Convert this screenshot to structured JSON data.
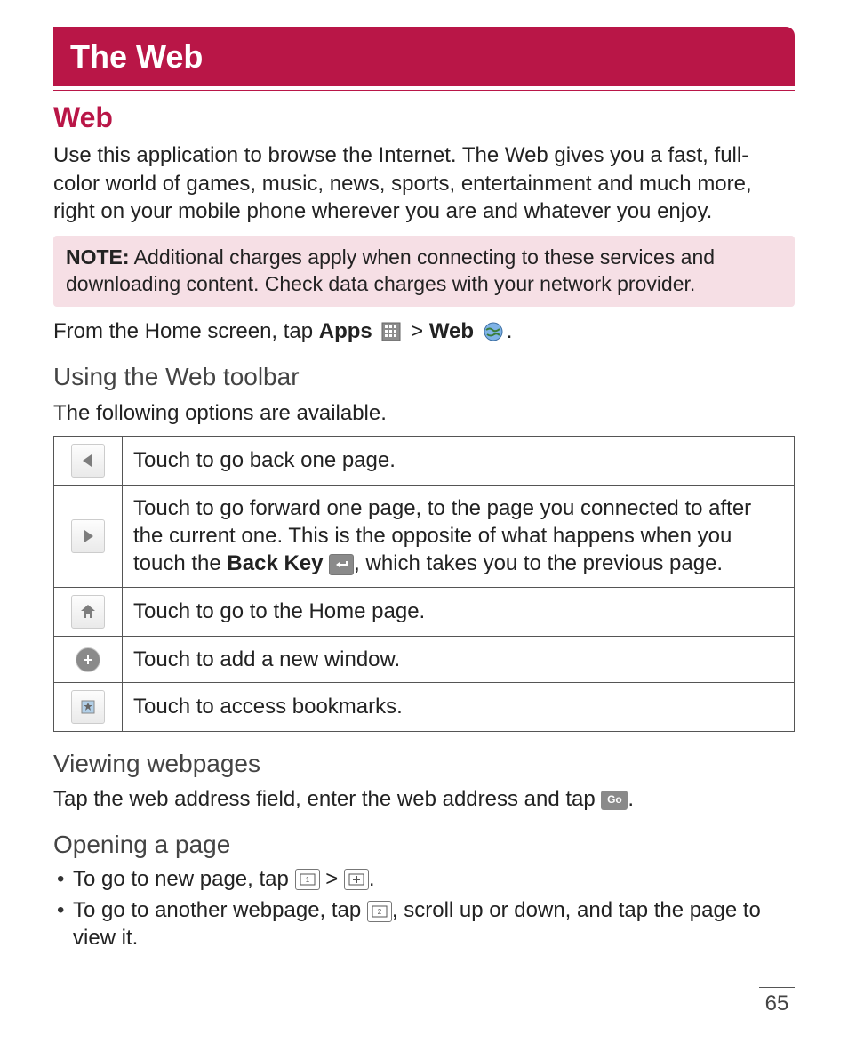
{
  "chapter_title": "The Web",
  "section_title": "Web",
  "intro_paragraph": "Use this application to browse the Internet. The Web gives you a fast, full-color world of games, music, news, sports, entertainment and much more, right on your mobile phone wherever you are and whatever you enjoy.",
  "note": {
    "label": "NOTE:",
    "text": " Additional charges apply when connecting to these services and downloading content. Check data charges with your network provider."
  },
  "from_home": {
    "pre": "From the Home screen, tap ",
    "apps": "Apps",
    "sep": " > ",
    "web": "Web",
    "period": "."
  },
  "toolbar_section": {
    "heading": "Using the Web toolbar",
    "lead": "The following options are available.",
    "rows": [
      {
        "icon": "back-arrow-icon",
        "desc_plain": "Touch to go back one page."
      },
      {
        "icon": "forward-arrow-icon",
        "desc_pre": "Touch to go forward one page, to the page you connected to after the current one. This is the opposite of what happens when you touch the ",
        "desc_bold": "Back Key",
        "desc_post": ", which takes you to the previous page."
      },
      {
        "icon": "home-icon",
        "desc_plain": "Touch to go to the Home page."
      },
      {
        "icon": "plus-icon",
        "desc_plain": "Touch to add a new window."
      },
      {
        "icon": "bookmark-icon",
        "desc_plain": " Touch to access bookmarks."
      }
    ]
  },
  "viewing": {
    "heading": "Viewing webpages",
    "text_pre": "Tap the web address field, enter the web address and tap ",
    "go_label": "Go",
    "text_post": "."
  },
  "opening": {
    "heading": "Opening a page",
    "bullet1_pre": "To go to new page, tap ",
    "bullet1_mid": " > ",
    "bullet1_post": ".",
    "bullet2_pre": "To go to another webpage, tap ",
    "bullet2_post": ", scroll up or down, and tap the page to view it."
  },
  "page_number": "65",
  "colors": {
    "accent": "#b91647"
  }
}
